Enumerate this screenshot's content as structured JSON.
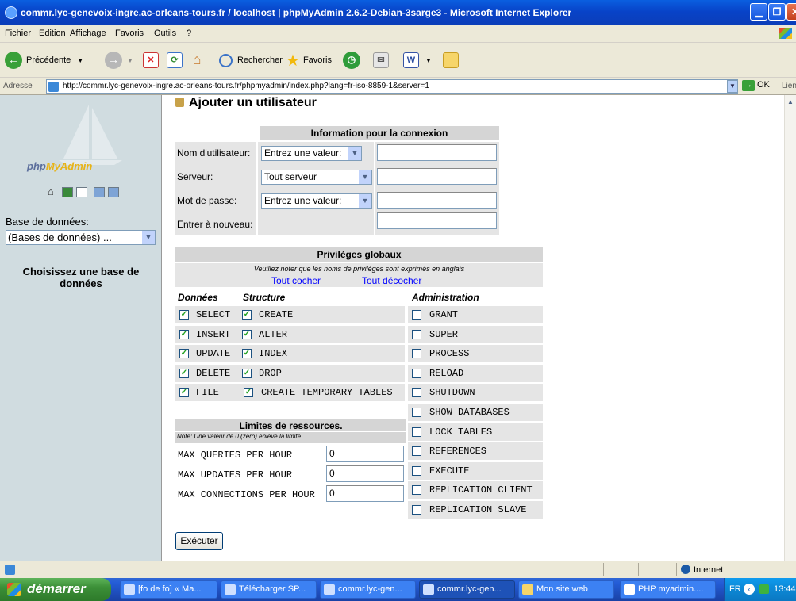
{
  "window": {
    "title": "commr.lyc-genevoix-ingre.ac-orleans-tours.fr / localhost | phpMyAdmin 2.6.2-Debian-3sarge3 - Microsoft Internet Explorer"
  },
  "menu": [
    "Fichier",
    "Edition",
    "Affichage",
    "Favoris",
    "Outils",
    "?"
  ],
  "toolbar": {
    "back_label": "Précédente",
    "search_label": "Rechercher",
    "favorites_label": "Favoris"
  },
  "address": {
    "label": "Adresse",
    "url": "http://commr.lyc-genevoix-ingre.ac-orleans-tours.fr/phpmyadmin/index.php?lang=fr-iso-8859-1&server=1",
    "go_label": "OK",
    "links_label": "Lien"
  },
  "left": {
    "logo_php": "php",
    "logo_my": "MyAdmin",
    "db_label": "Base de données:",
    "db_select": "(Bases de données) ...",
    "choose": "Choisissez une base de données"
  },
  "main": {
    "title": "Ajouter un utilisateur",
    "login": {
      "header": "Information pour la connexion",
      "user_label": "Nom d'utilisateur:",
      "user_select": "Entrez une valeur:",
      "server_label": "Serveur:",
      "server_select": "Tout serveur",
      "password_label": "Mot de passe:",
      "password_select": "Entrez une valeur:",
      "retype_label": "Entrer à nouveau:"
    },
    "privileges": {
      "header": "Privilèges globaux",
      "note": "Veuillez noter que les noms de privilèges sont exprimés en anglais",
      "check_all": "Tout cocher",
      "uncheck_all": "Tout décocher",
      "col_data": "Données",
      "col_structure": "Structure",
      "col_admin": "Administration",
      "data": [
        "SELECT",
        "INSERT",
        "UPDATE",
        "DELETE",
        "FILE"
      ],
      "structure": [
        "CREATE",
        "ALTER",
        "INDEX",
        "DROP",
        "CREATE TEMPORARY TABLES"
      ],
      "admin": [
        "GRANT",
        "SUPER",
        "PROCESS",
        "RELOAD",
        "SHUTDOWN",
        "SHOW DATABASES",
        "LOCK TABLES",
        "REFERENCES",
        "EXECUTE",
        "REPLICATION CLIENT",
        "REPLICATION SLAVE"
      ]
    },
    "limits": {
      "header": "Limites de ressources.",
      "note": "Note: Une valeur de 0 (zero) enlève la limite.",
      "rows": [
        {
          "label": "MAX QUERIES PER HOUR",
          "value": "0"
        },
        {
          "label": "MAX UPDATES PER HOUR",
          "value": "0"
        },
        {
          "label": "MAX CONNECTIONS PER HOUR",
          "value": "0"
        }
      ]
    },
    "submit": "Exécuter"
  },
  "status": {
    "zone": "Internet"
  },
  "taskbar": {
    "start": "démarrer",
    "tasks": [
      "[fo de fo] « Ma...",
      "Télécharger SP...",
      "commr.lyc-gen...",
      "commr.lyc-gen...",
      "Mon site web",
      "PHP myadmin...."
    ],
    "lang": "FR",
    "clock": "13:44"
  }
}
